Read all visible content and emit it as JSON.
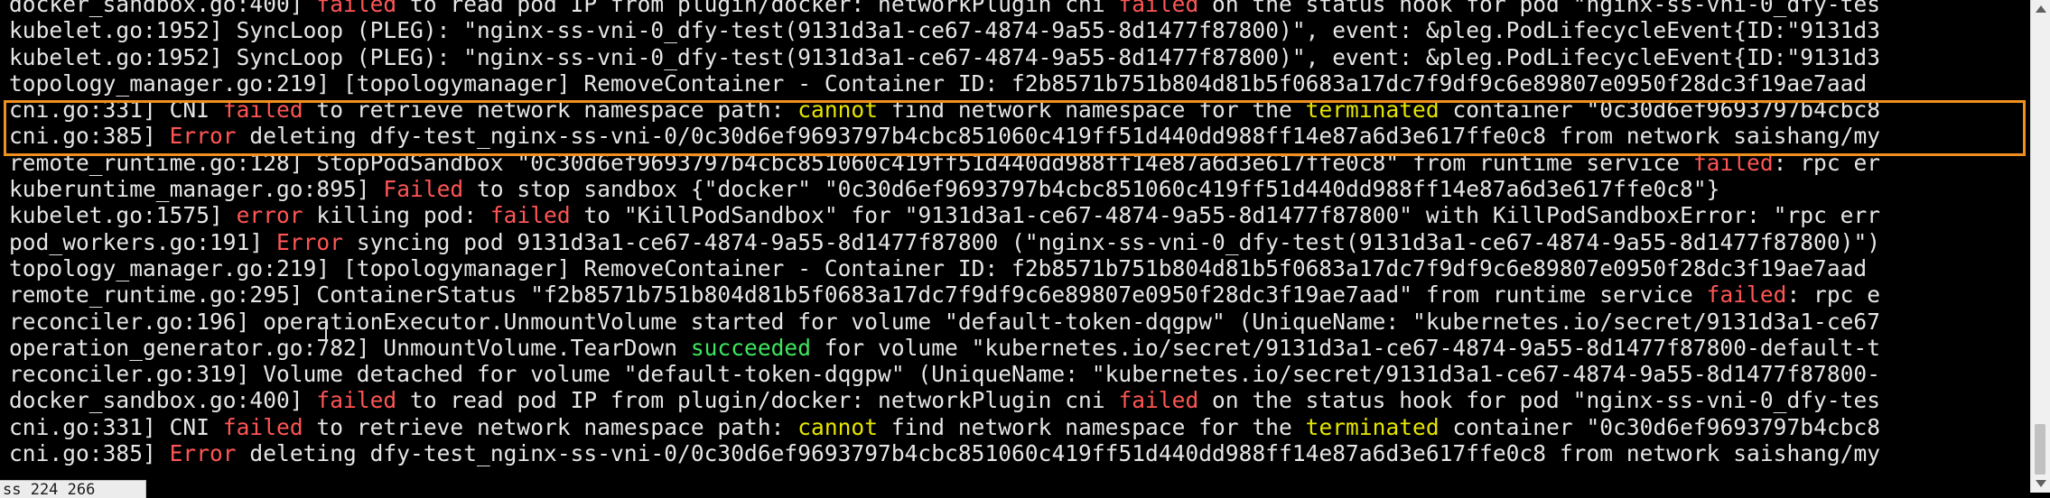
{
  "window": {
    "status_text": "ss 224 266"
  },
  "colors": {
    "text": "#e6e6e6",
    "red": "#ff5555",
    "yellow": "#e6e600",
    "green": "#3ee65e",
    "highlight": "#f0901e",
    "background": "#000000"
  },
  "log_lines": [
    {
      "segments": [
        {
          "t": "docker_sandbox.go:400] ",
          "c": "text"
        },
        {
          "t": "failed",
          "c": "red"
        },
        {
          "t": " to read pod IP from plugin/docker: networkPlugin cni ",
          "c": "text"
        },
        {
          "t": "failed",
          "c": "red"
        },
        {
          "t": " on the status hook for pod \"nginx-ss-vni-0_dfy-tes",
          "c": "text"
        }
      ]
    },
    {
      "segments": [
        {
          "t": "kubelet.go:1952] SyncLoop (PLEG): \"nginx-ss-vni-0_dfy-test(9131d3a1-ce67-4874-9a55-8d1477f87800)\", event: &pleg.PodLifecycleEvent{ID:\"9131d3",
          "c": "text"
        }
      ]
    },
    {
      "segments": [
        {
          "t": "kubelet.go:1952] SyncLoop (PLEG): \"nginx-ss-vni-0_dfy-test(9131d3a1-ce67-4874-9a55-8d1477f87800)\", event: &pleg.PodLifecycleEvent{ID:\"9131d3",
          "c": "text"
        }
      ]
    },
    {
      "segments": [
        {
          "t": "topology_manager.go:219] [topologymanager] RemoveContainer - Container ID: f2b8571b751b804d81b5f0683a17dc7f9df9c6e89807e0950f28dc3f19ae7aad",
          "c": "text"
        }
      ]
    },
    {
      "segments": [
        {
          "t": "cni.go:331] CNI ",
          "c": "text"
        },
        {
          "t": "failed",
          "c": "red"
        },
        {
          "t": " to retrieve network namespace path: ",
          "c": "text"
        },
        {
          "t": "cannot",
          "c": "yellow"
        },
        {
          "t": " find network namespace for the ",
          "c": "text"
        },
        {
          "t": "terminated",
          "c": "yellow"
        },
        {
          "t": " container \"0c30d6ef9693797b4cbc8",
          "c": "text"
        }
      ]
    },
    {
      "segments": [
        {
          "t": "cni.go:385] ",
          "c": "text"
        },
        {
          "t": "Error",
          "c": "red"
        },
        {
          "t": " deleting dfy-test_nginx-ss-vni-0/0c30d6ef9693797b4cbc851060c419ff51d440dd988ff14e87a6d3e617ffe0c8 from network saishang/my",
          "c": "text"
        }
      ]
    },
    {
      "segments": [
        {
          "t": "remote_runtime.go:128] StopPodSandbox \"0c30d6ef9693797b4cbc851060c419ff51d440dd988ff14e87a6d3e617ffe0c8\" from runtime service ",
          "c": "text"
        },
        {
          "t": "failed",
          "c": "red"
        },
        {
          "t": ": rpc er",
          "c": "text"
        }
      ]
    },
    {
      "segments": [
        {
          "t": "kuberuntime_manager.go:895] ",
          "c": "text"
        },
        {
          "t": "Failed",
          "c": "red"
        },
        {
          "t": " to stop sandbox {\"docker\" \"0c30d6ef9693797b4cbc851060c419ff51d440dd988ff14e87a6d3e617ffe0c8\"}",
          "c": "text"
        }
      ]
    },
    {
      "segments": [
        {
          "t": "kubelet.go:1575] ",
          "c": "text"
        },
        {
          "t": "error",
          "c": "red"
        },
        {
          "t": " killing pod: ",
          "c": "text"
        },
        {
          "t": "failed",
          "c": "red"
        },
        {
          "t": " to \"KillPodSandbox\" for \"9131d3a1-ce67-4874-9a55-8d1477f87800\" with KillPodSandboxError: \"rpc err",
          "c": "text"
        }
      ]
    },
    {
      "segments": [
        {
          "t": "pod_workers.go:191] ",
          "c": "text"
        },
        {
          "t": "Error",
          "c": "red"
        },
        {
          "t": " syncing pod 9131d3a1-ce67-4874-9a55-8d1477f87800 (\"nginx-ss-vni-0_dfy-test(9131d3a1-ce67-4874-9a55-8d1477f87800)\")",
          "c": "text"
        }
      ]
    },
    {
      "segments": [
        {
          "t": "topology_manager.go:219] [topologymanager] RemoveContainer - Container ID: f2b8571b751b804d81b5f0683a17dc7f9df9c6e89807e0950f28dc3f19ae7aad",
          "c": "text"
        }
      ]
    },
    {
      "segments": [
        {
          "t": "remote_runtime.go:295] ContainerStatus \"f2b8571b751b804d81b5f0683a17dc7f9df9c6e89807e0950f28dc3f19ae7aad\" from runtime service ",
          "c": "text"
        },
        {
          "t": "failed",
          "c": "red"
        },
        {
          "t": ": rpc e",
          "c": "text"
        }
      ]
    },
    {
      "segments": [
        {
          "t": "reconciler.go:196] operationExecutor.UnmountVolume started for volume \"default-token-dqgpw\" (UniqueName: \"kubernetes.io/secret/9131d3a1-ce67",
          "c": "text"
        }
      ]
    },
    {
      "segments": [
        {
          "t": "operation_generator.go:782] UnmountVolume.TearDown ",
          "c": "text"
        },
        {
          "t": "succeeded",
          "c": "green"
        },
        {
          "t": " for volume \"kubernetes.io/secret/9131d3a1-ce67-4874-9a55-8d1477f87800-default-t",
          "c": "text"
        }
      ]
    },
    {
      "segments": [
        {
          "t": "reconciler.go:319] Volume detached for volume \"default-token-dqgpw\" (UniqueName: \"kubernetes.io/secret/9131d3a1-ce67-4874-9a55-8d1477f87800-",
          "c": "text"
        }
      ]
    },
    {
      "segments": [
        {
          "t": "docker_sandbox.go:400] ",
          "c": "text"
        },
        {
          "t": "failed",
          "c": "red"
        },
        {
          "t": " to read pod IP from plugin/docker: networkPlugin cni ",
          "c": "text"
        },
        {
          "t": "failed",
          "c": "red"
        },
        {
          "t": " on the status hook for pod \"nginx-ss-vni-0_dfy-tes",
          "c": "text"
        }
      ]
    },
    {
      "segments": [
        {
          "t": "cni.go:331] CNI ",
          "c": "text"
        },
        {
          "t": "failed",
          "c": "red"
        },
        {
          "t": " to retrieve network namespace path: ",
          "c": "text"
        },
        {
          "t": "cannot",
          "c": "yellow"
        },
        {
          "t": " find network namespace for the ",
          "c": "text"
        },
        {
          "t": "terminated",
          "c": "yellow"
        },
        {
          "t": " container \"0c30d6ef9693797b4cbc8",
          "c": "text"
        }
      ]
    },
    {
      "segments": [
        {
          "t": "cni.go:385] ",
          "c": "text"
        },
        {
          "t": "Error",
          "c": "red"
        },
        {
          "t": " deleting dfy-test_nginx-ss-vni-0/0c30d6ef9693797b4cbc851060c419ff51d440dd988ff14e87a6d3e617ffe0c8 from network saishang/my",
          "c": "text"
        }
      ]
    }
  ]
}
